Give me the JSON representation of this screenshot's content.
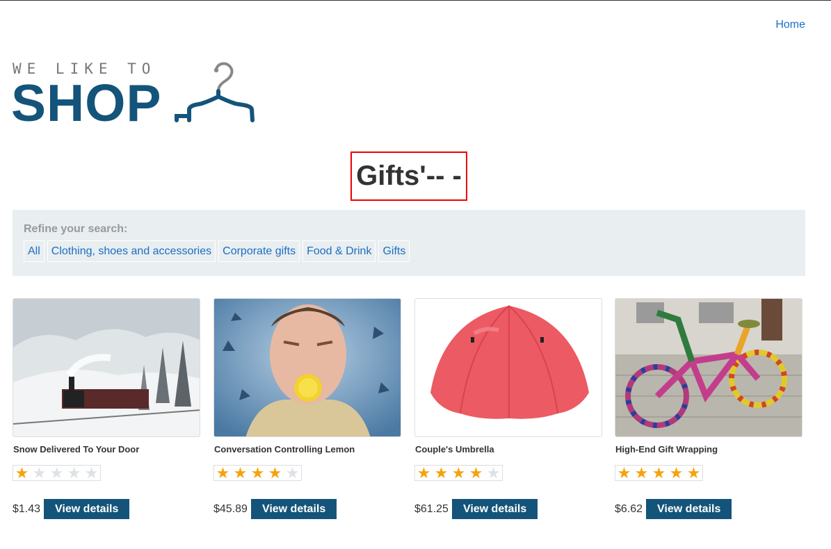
{
  "nav": {
    "home_label": "Home"
  },
  "logo": {
    "tagline": "WE LIKE TO",
    "word": "SHOP"
  },
  "page": {
    "title": "Gifts'-- -"
  },
  "refine": {
    "label": "Refine your search:",
    "filters": [
      "All",
      "Clothing, shoes and accessories",
      "Corporate gifts",
      "Food & Drink",
      "Gifts"
    ]
  },
  "products": [
    {
      "name": "Snow Delivered To Your Door",
      "rating": 1,
      "price": "$1.43",
      "button": "View details",
      "image": "snowy-train-image"
    },
    {
      "name": "Conversation Controlling Lemon",
      "rating": 4,
      "price": "$45.89",
      "button": "View details",
      "image": "lemon-mouth-man-image"
    },
    {
      "name": "Couple's Umbrella",
      "rating": 4,
      "price": "$61.25",
      "button": "View details",
      "image": "red-double-umbrella-image"
    },
    {
      "name": "High-End Gift Wrapping",
      "rating": 5,
      "price": "$6.62",
      "button": "View details",
      "image": "knitted-bicycle-image"
    }
  ],
  "colors": {
    "brand": "#14547a",
    "link": "#1a6ec4",
    "star_on": "#f5a30c",
    "star_off": "#dde2e6",
    "highlight_border": "#ee0000"
  }
}
